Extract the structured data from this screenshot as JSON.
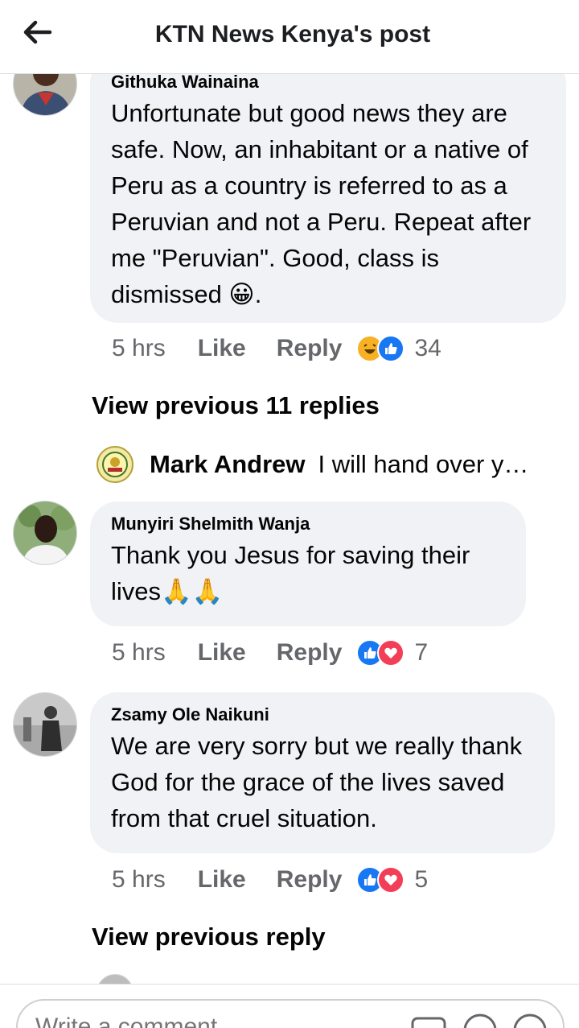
{
  "header": {
    "title": "KTN News Kenya's post"
  },
  "comments": [
    {
      "author": "Githuka Wainaina",
      "text": "Unfortunate but good news they are safe. Now, an inhabitant or a native of Peru as a country is referred to as a Peruvian and not a Peru. Repeat after me \"Peruvian\". Good, class is dismissed 😀.",
      "time": "5 hrs",
      "like": "Like",
      "reply": "Reply",
      "reactions": [
        "haha",
        "like"
      ],
      "count": "34"
    },
    {
      "author": "Munyiri Shelmith Wanja",
      "text": "Thank you Jesus for saving their lives🙏🙏",
      "time": "5 hrs",
      "like": "Like",
      "reply": "Reply",
      "reactions": [
        "like",
        "love"
      ],
      "count": "7"
    },
    {
      "author": "Zsamy Ole Naikuni",
      "text": "We are very sorry but we really thank God for the grace of the lives saved from that cruel situation.",
      "time": "5 hrs",
      "like": "Like",
      "reply": "Reply",
      "reactions": [
        "like",
        "love"
      ],
      "count": "5"
    }
  ],
  "view_previous_replies": "View previous 11 replies",
  "view_previous_reply": "View previous reply",
  "reply_preview": {
    "author": "Mark Andrew",
    "text": "I will hand over y…"
  },
  "composer": {
    "placeholder": "Write a comment..."
  },
  "colors": {
    "like": "#1877f2",
    "love": "#f33e58",
    "haha": "#f7b125",
    "bubble": "#f0f2f5",
    "meta": "#65676b"
  }
}
